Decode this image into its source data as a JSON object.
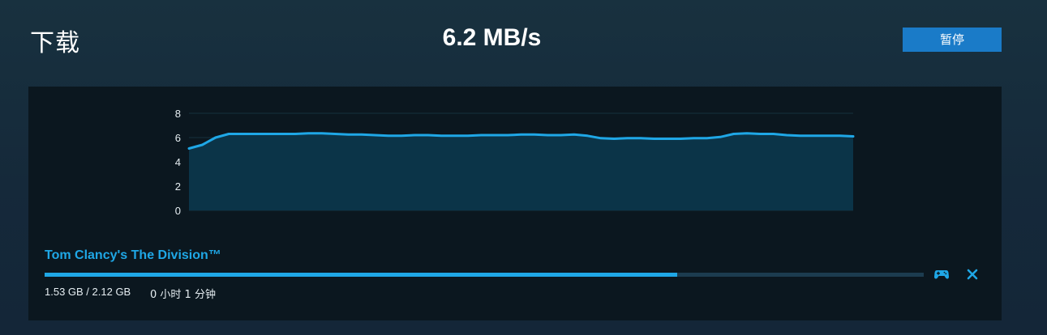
{
  "header": {
    "title": "下载",
    "speed": "6.2 MB/s",
    "pause_label": "暂停"
  },
  "chart_data": {
    "type": "area",
    "y_ticks": [
      "8",
      "6",
      "4",
      "2",
      "0"
    ],
    "ylim": [
      0,
      8
    ],
    "grid": true,
    "x": [
      0,
      1,
      2,
      3,
      4,
      5,
      6,
      7,
      8,
      9,
      10,
      11,
      12,
      13,
      14,
      15,
      16,
      17,
      18,
      19,
      20,
      21,
      22,
      23,
      24,
      25,
      26,
      27,
      28,
      29,
      30,
      31,
      32,
      33,
      34,
      35,
      36,
      37,
      38,
      39,
      40,
      41,
      42,
      43,
      44,
      45,
      46,
      47,
      48,
      49,
      50
    ],
    "values": [
      5.1,
      5.4,
      6.0,
      6.3,
      6.3,
      6.3,
      6.3,
      6.3,
      6.3,
      6.35,
      6.35,
      6.3,
      6.25,
      6.25,
      6.2,
      6.15,
      6.15,
      6.2,
      6.2,
      6.15,
      6.15,
      6.15,
      6.2,
      6.2,
      6.2,
      6.25,
      6.25,
      6.2,
      6.2,
      6.25,
      6.15,
      5.95,
      5.9,
      5.95,
      5.95,
      5.9,
      5.9,
      5.9,
      5.95,
      5.95,
      6.05,
      6.3,
      6.35,
      6.3,
      6.3,
      6.2,
      6.15,
      6.15,
      6.15,
      6.15,
      6.1
    ],
    "colors": {
      "line": "#1fa7e6",
      "fill": "#0b3448",
      "grid": "#16303d",
      "tick": "#e6eef2"
    }
  },
  "download": {
    "title": "Tom Clancy's The Division™",
    "progress": 0.72,
    "size": "1.53 GB / 2.12 GB",
    "time_remaining": "0 小时 1 分钟",
    "progress_fill_color": "#1fa7e6",
    "progress_track_color": "#1c3c4f"
  },
  "icons": {
    "gamepad": "gamepad-icon",
    "close": "close-icon"
  }
}
